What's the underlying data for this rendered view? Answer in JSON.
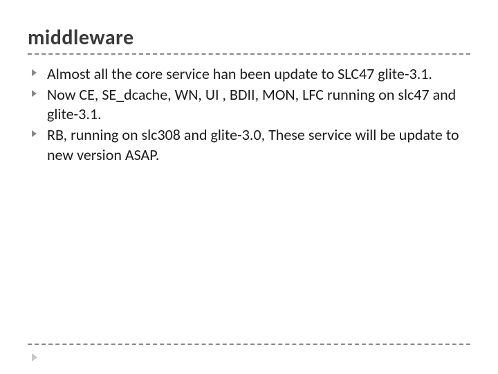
{
  "slide": {
    "title": "middleware",
    "bullets": [
      "Almost all the core service han been update to  SLC47 glite-3.1.",
      "Now CE, SE_dcache, WN, UI , BDII, MON, LFC running on slc47 and glite-3.1.",
      "RB, running on slc308 and glite-3.0, These service will be update to new version ASAP."
    ]
  }
}
